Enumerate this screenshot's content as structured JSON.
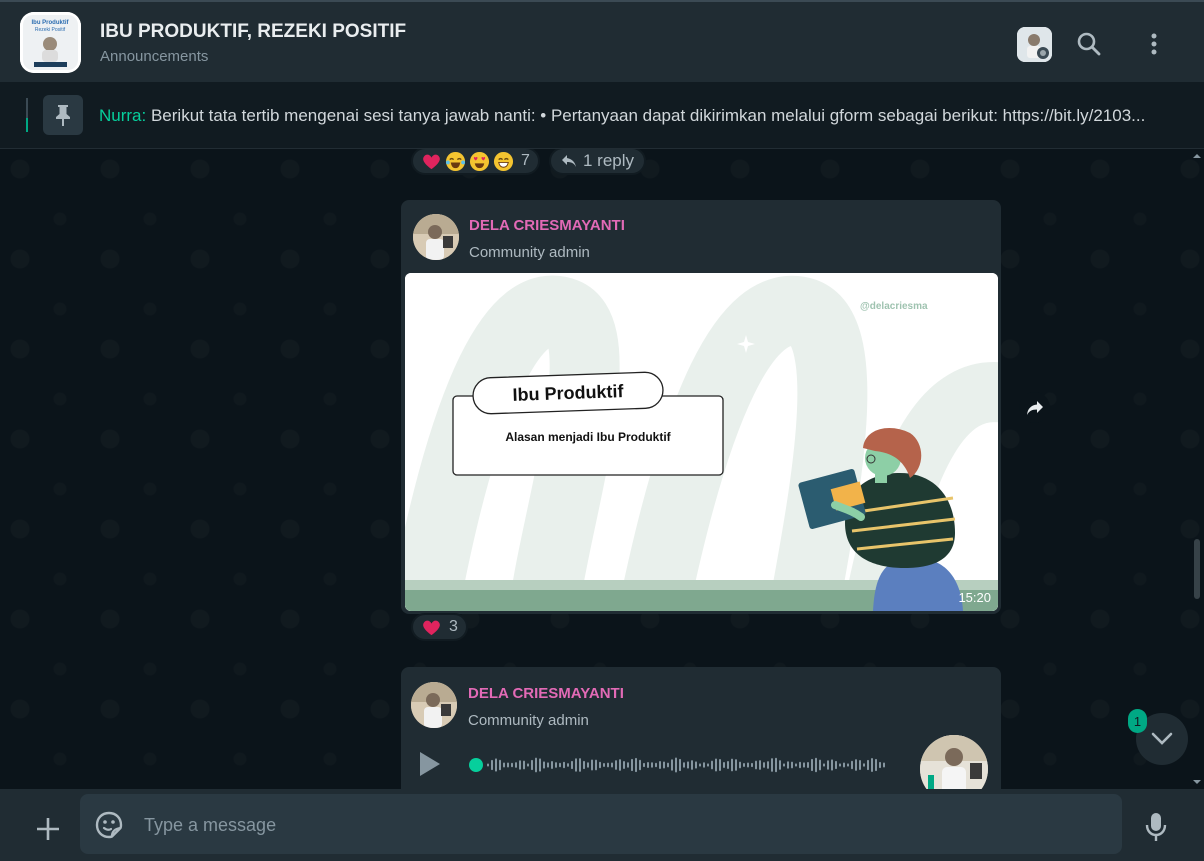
{
  "header": {
    "title": "IBU PRODUKTIF, REZEKI POSITIF",
    "subtitle": "Announcements"
  },
  "pinned": {
    "author": "Nurra:",
    "text": " Berikut tata tertib mengenai sesi tanya jawab nanti: • Pertanyaan dapat dikirimkan melalui gform sebagai berikut: https://bit.ly/2103..."
  },
  "prev_message": {
    "reaction_count": "7",
    "reply_label": "1 reply"
  },
  "message1": {
    "sender": "DELA CRIESMAYANTI",
    "role": "Community admin",
    "image": {
      "watermark": "@delacriesma",
      "heading": "Ibu Produktif",
      "caption": "Alasan menjadi Ibu Produktif"
    },
    "time": "15:20",
    "reaction_count": "3"
  },
  "message2": {
    "sender": "DELA CRIESMAYANTI",
    "role": "Community admin"
  },
  "scroll": {
    "unread_count": "1"
  },
  "composer": {
    "placeholder": "Type a message"
  },
  "colors": {
    "accent": "#00a884",
    "sender_name": "#e26ab6",
    "bubble": "#202c33",
    "background": "#0b141a"
  }
}
